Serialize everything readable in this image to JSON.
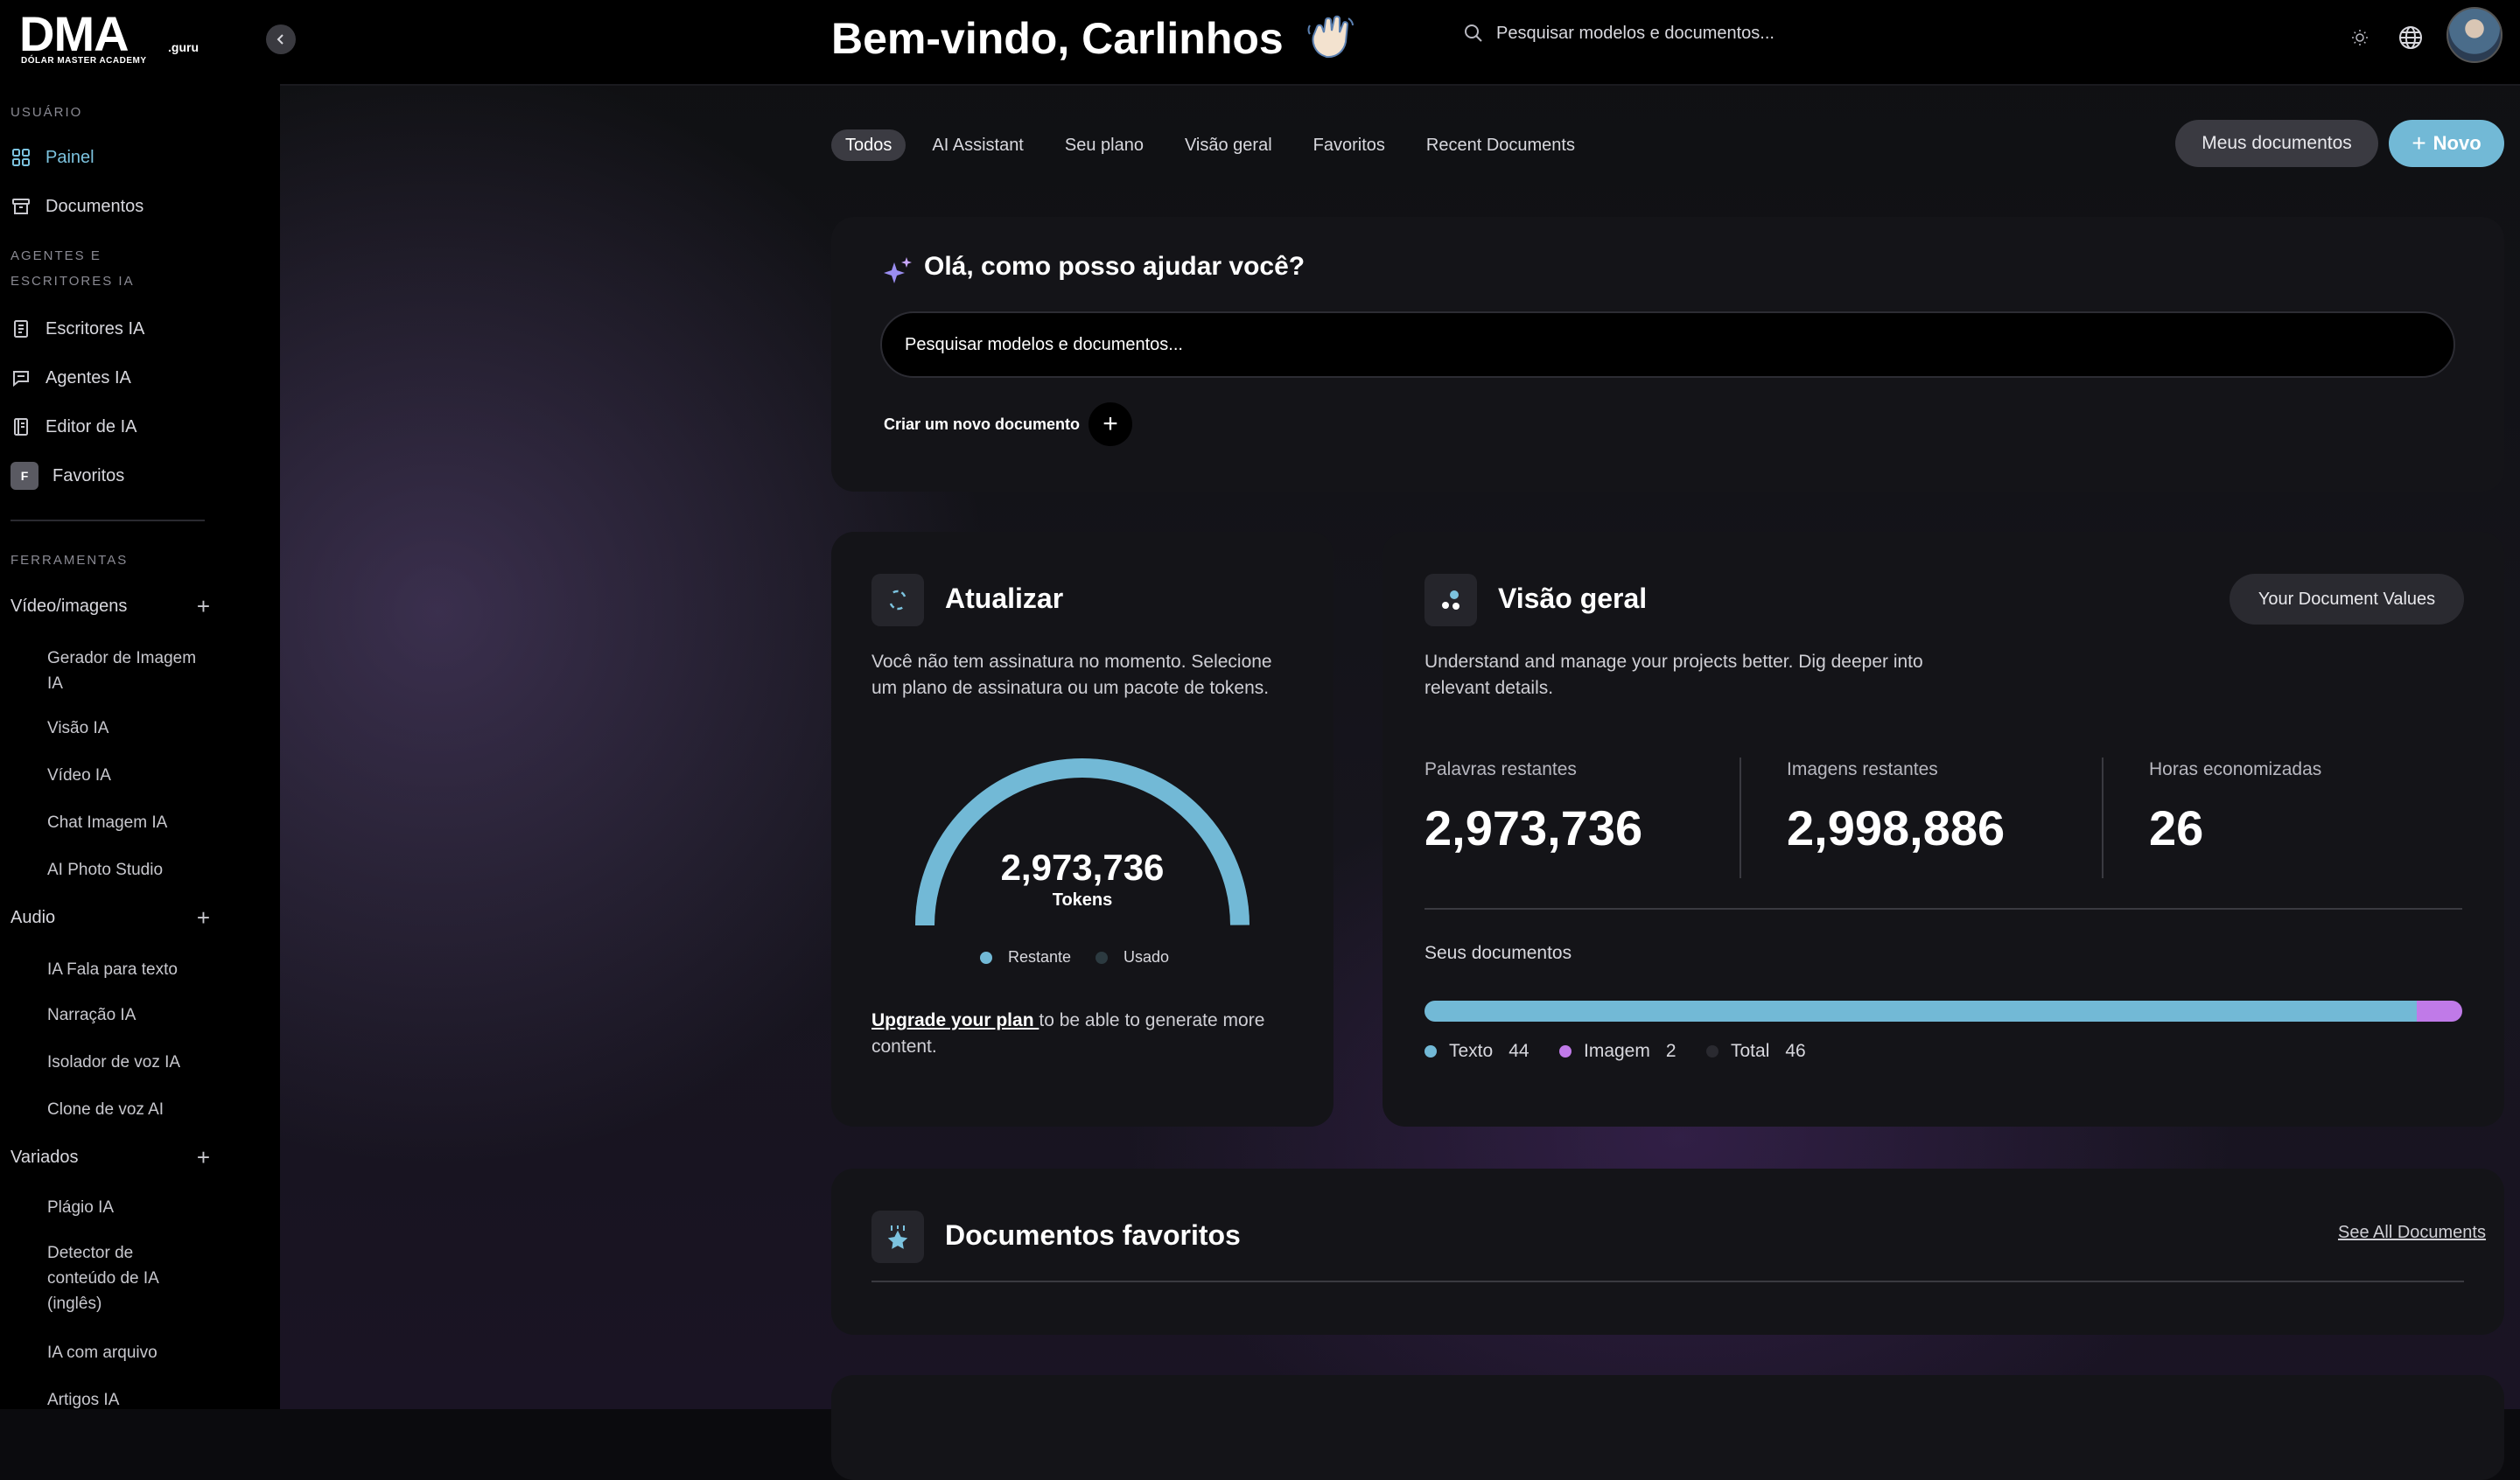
{
  "brand": {
    "name": "DMA",
    "suffix": ".guru",
    "tagline": "DÓLAR MASTER ACADEMY"
  },
  "sidebar": {
    "section_user": "USUÁRIO",
    "nav_painel": "Painel",
    "nav_documentos": "Documentos",
    "section_agents": "AGENTES E ESCRITORES IA",
    "nav_escritores": "Escritores IA",
    "nav_agentes": "Agentes IA",
    "nav_editor": "Editor de IA",
    "nav_favoritos": "Favoritos",
    "favoritos_badge": "F",
    "section_tools": "FERRAMENTAS",
    "group_video": "Vídeo/imagens",
    "video_items": [
      "Gerador de Imagem IA",
      "Visão IA",
      "Vídeo IA",
      "Chat Imagem IA",
      "AI Photo Studio"
    ],
    "group_audio": "Audio",
    "audio_items": [
      "IA Fala para texto",
      "Narração IA",
      "Isolador de voz IA",
      "Clone de voz AI"
    ],
    "group_variados": "Variados",
    "variados_items": [
      "Plágio IA",
      "Detector de conteúdo de IA (inglês)",
      "IA com arquivo",
      "Artigos IA"
    ],
    "group_plus": "+"
  },
  "header": {
    "welcome": "Bem-vindo, Carlinhos",
    "wave_icon": "waving-hand-icon",
    "search_placeholder": "Pesquisar modelos e documentos..."
  },
  "tabs": [
    "Todos",
    "AI Assistant",
    "Seu plano",
    "Visão geral",
    "Favoritos",
    "Recent Documents"
  ],
  "actions": {
    "my_docs": "Meus documentos",
    "new_plus": "+",
    "new": "Novo"
  },
  "assistant": {
    "title": "Olá, como posso ajudar você?",
    "input_placeholder": "Pesquisar modelos e documentos...",
    "create_label": "Criar um novo documento",
    "create_plus": "+"
  },
  "upgrade_card": {
    "title": "Atualizar",
    "description": "Você não tem assinatura no momento. Selecione um plano de assinatura ou um pacote de tokens.",
    "gauge_value": "2,973,736",
    "gauge_unit": "Tokens",
    "remaining_fraction": 0.999,
    "legend_remaining": "Restante",
    "legend_used": "Usado",
    "upgrade_link": "Upgrade your plan ",
    "upgrade_rest": "to be able to generate more content.",
    "colors": {
      "remaining": "#72b9d6",
      "used": "#2c3a40"
    }
  },
  "overview_card": {
    "title": "Visão geral",
    "pill": "Your Document Values",
    "description": "Understand and manage your projects better. Dig deeper into relevant details.",
    "stats": [
      {
        "label": "Palavras restantes",
        "value": "2,973,736"
      },
      {
        "label": "Imagens restantes",
        "value": "2,998,886"
      },
      {
        "label": "Horas economizadas",
        "value": "26"
      }
    ],
    "docs_label": "Seus documentos",
    "docs": {
      "texto_label": "Texto",
      "texto_count": 44,
      "imagem_label": "Imagem",
      "imagem_count": 2,
      "total_label": "Total",
      "total_count": 46
    },
    "colors": {
      "texto": "#72b9d6",
      "imagem": "#c07ae8",
      "total": "#2a2a30"
    }
  },
  "favorites_card": {
    "title": "Documentos favoritos",
    "see_all": "See All Documents"
  }
}
